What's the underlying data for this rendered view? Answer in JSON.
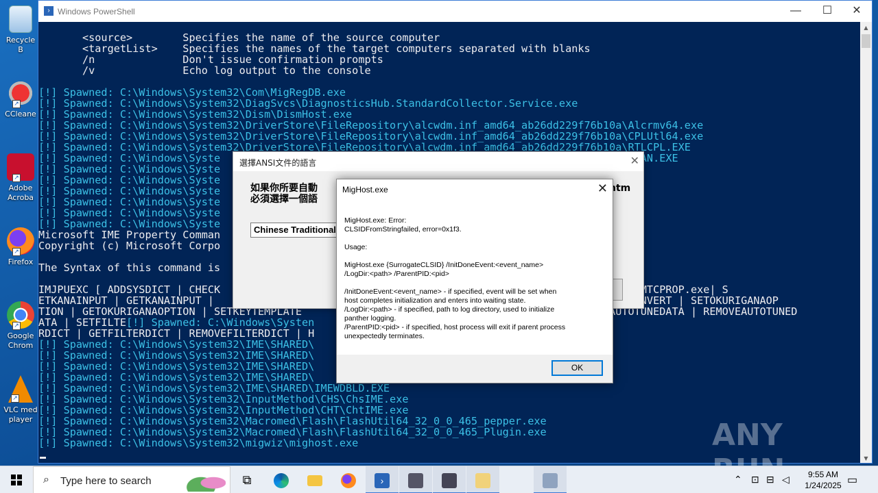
{
  "desktop": {
    "icons": [
      {
        "label": "Recycle Bin",
        "short": "Recycle B"
      },
      {
        "label": "CCleaner",
        "short": "CCleane"
      },
      {
        "label": "Adobe Acrobat",
        "short": "Adobe Acroba"
      },
      {
        "label": "Firefox",
        "short": "Firefox"
      },
      {
        "label": "Google Chrome",
        "short": "Google Chrom"
      },
      {
        "label": "VLC media player",
        "short": "VLC med player"
      }
    ]
  },
  "powershell": {
    "title": "Windows PowerShell",
    "lines": [
      {
        "t": "       <source>        Specifies the name of the source computer",
        "c": "w"
      },
      {
        "t": "       <targetList>    Specifies the names of the target computers separated with blanks",
        "c": "w"
      },
      {
        "t": "       /n              Don't issue confirmation prompts",
        "c": "w"
      },
      {
        "t": "       /v              Echo log output to the console",
        "c": "w"
      },
      {
        "t": "",
        "c": "w"
      },
      {
        "t": "[!] Spawned: C:\\Windows\\System32\\Com\\MigRegDB.exe",
        "c": "s"
      },
      {
        "t": "[!] Spawned: C:\\Windows\\System32\\DiagSvcs\\DiagnosticsHub.StandardCollector.Service.exe",
        "c": "s"
      },
      {
        "t": "[!] Spawned: C:\\Windows\\System32\\Dism\\DismHost.exe",
        "c": "s"
      },
      {
        "t": "[!] Spawned: C:\\Windows\\System32\\DriverStore\\FileRepository\\alcwdm.inf_amd64_ab26dd229f76b10a\\Alcrmv64.exe",
        "c": "s"
      },
      {
        "t": "[!] Spawned: C:\\Windows\\System32\\DriverStore\\FileRepository\\alcwdm.inf_amd64_ab26dd229f76b10a\\CPLUtl64.exe",
        "c": "s"
      },
      {
        "t": "[!] Spawned: C:\\Windows\\System32\\DriverStore\\FileRepository\\alcwdm.inf_amd64_ab26dd229f76b10a\\RTLCPL.EXE",
        "c": "s"
      },
      {
        "t": "[!] Spawned: C:\\Windows\\Syste                                                       6b10a\\SOUNDMAN.EXE",
        "c": "s"
      },
      {
        "t": "[!] Spawned: C:\\Windows\\Syste",
        "c": "s"
      },
      {
        "t": "[!] Spawned: C:\\Windows\\Syste",
        "c": "s"
      },
      {
        "t": "[!] Spawned: C:\\Windows\\Syste",
        "c": "s"
      },
      {
        "t": "[!] Spawned: C:\\Windows\\Syste",
        "c": "s"
      },
      {
        "t": "[!] Spawned: C:\\Windows\\Syste",
        "c": "s"
      },
      {
        "t": "[!] Spawned: C:\\Windows\\Syste",
        "c": "s"
      },
      {
        "t": "Microsoft IME Property Comman",
        "c": "w"
      },
      {
        "t": "Copyright (c) Microsoft Corpo",
        "c": "w"
      },
      {
        "t": "",
        "c": "w"
      },
      {
        "t": "The Syntax of this command is",
        "c": "w"
      },
      {
        "t": "",
        "c": "w"
      },
      {
        "t": "IMJPUEXC [ ADDSYSDICT | CHECK                                                          E\\IMETC\\IMTCPROP.exe| S",
        "c": "w"
      },
      {
        "t": "ETKANAINPUT | GETKANAINPUT |                                                          EAREAFORCONVERT | SETOKURIGANAOP",
        "c": "w"
      },
      {
        "t": "TION | GETOKURIGANAOPTION | SETKEYTEMPLATE                                           | SAVEAUTOTUNEDATA | REMOVEAUTOTUNED",
        "c": "w"
      },
      {
        "t": "ATA | SETFILTE",
        "c": "w",
        "tail": "[!] Spawned: C:\\Windows\\Systen"
      },
      {
        "t": "RDICT | GETFILTERDICT | REMOVEFILTERDICT | H",
        "c": "w"
      },
      {
        "t": "[!] Spawned: C:\\Windows\\System32\\IME\\SHARED\\",
        "c": "s"
      },
      {
        "t": "[!] Spawned: C:\\Windows\\System32\\IME\\SHARED\\",
        "c": "s"
      },
      {
        "t": "[!] Spawned: C:\\Windows\\System32\\IME\\SHARED\\",
        "c": "s"
      },
      {
        "t": "[!] Spawned: C:\\Windows\\System32\\IME\\SHARED\\",
        "c": "s"
      },
      {
        "t": "[!] Spawned: C:\\Windows\\System32\\IME\\SHARED\\IMEWDBLD.EXE",
        "c": "s"
      },
      {
        "t": "[!] Spawned: C:\\Windows\\System32\\InputMethod\\CHS\\ChsIME.exe",
        "c": "s"
      },
      {
        "t": "[!] Spawned: C:\\Windows\\System32\\InputMethod\\CHT\\ChtIME.exe",
        "c": "s"
      },
      {
        "t": "[!] Spawned: C:\\Windows\\System32\\Macromed\\Flash\\FlashUtil64_32_0_0_465_pepper.exe",
        "c": "s"
      },
      {
        "t": "[!] Spawned: C:\\Windows\\System32\\Macromed\\Flash\\FlashUtil64_32_0_0_465_Plugin.exe",
        "c": "s"
      },
      {
        "t": "[!] Spawned: C:\\Windows\\System32\\migwiz\\mighost.exe",
        "c": "s"
      }
    ]
  },
  "ansi_dialog": {
    "title": "選擇ANSI文件的語言",
    "message_line1": "如果你所要自動",
    "message_line2": "必須選擇一個語",
    "message_right": "htm",
    "selected_language": "Chinese Traditional"
  },
  "mighost_dialog": {
    "title": "MigHost.exe",
    "paragraphs": [
      "MigHost.exe: Error:\nCLSIDFromStringfailed, error=0x1f3.",
      "Usage:",
      "MigHost.exe {SurrogateCLSID} /InitDoneEvent:<event_name>\n/LogDir:<path> /ParentPID:<pid>",
      "/InitDoneEvent:<event_name> - if specified, event will be set when\nhost completes initialization and enters into waiting state.\n/LogDir:<path> - if specified, path to log directory, used to initialize\npanther logging.\n/ParentPID:<pid> - if specified, host process will exit if parent process\nunexpectedly terminates."
    ],
    "ok_label": "OK"
  },
  "watermark": "ANY RUN",
  "taskbar": {
    "search_placeholder": "Type here to search",
    "time": "9:55 AM",
    "date": "1/24/2025",
    "apps": [
      "task-view",
      "edge",
      "file-explorer",
      "firefox",
      "powershell",
      "app-1",
      "app-2",
      "app-3",
      "app-4"
    ]
  }
}
